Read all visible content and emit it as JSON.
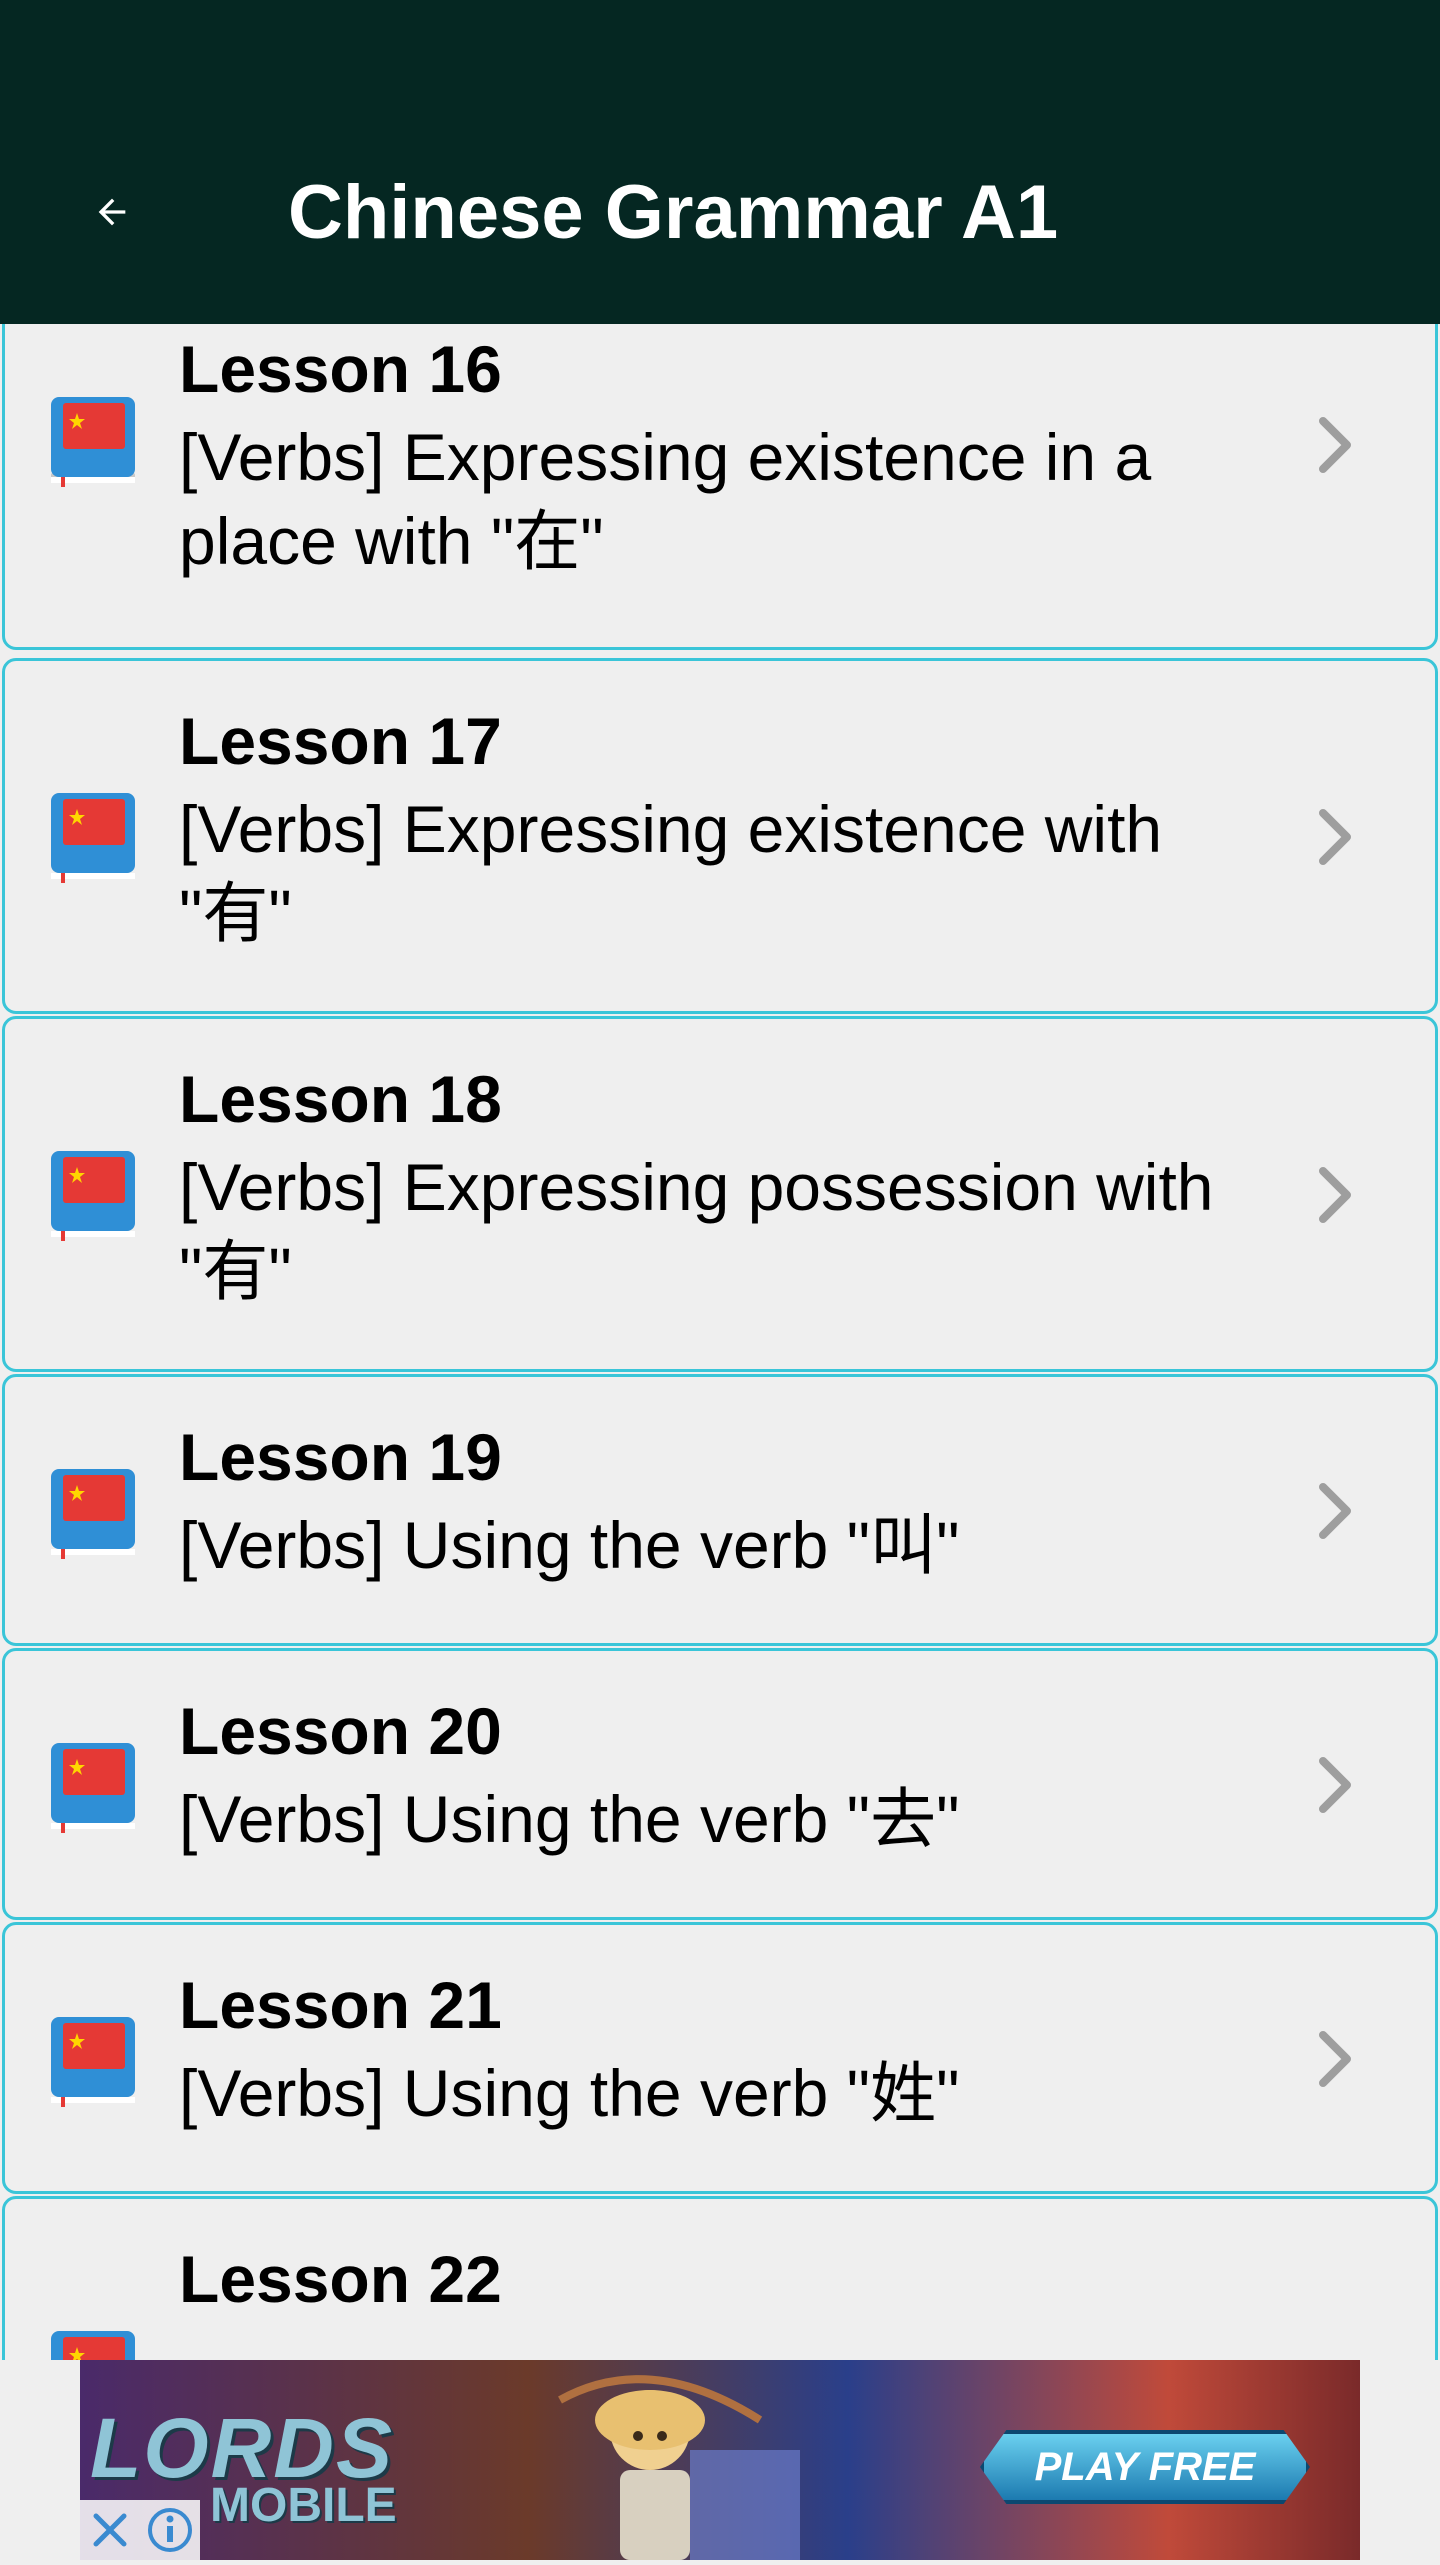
{
  "app_bar": {
    "title": "Chinese Grammar A1",
    "back_icon": "arrow-left-icon",
    "background": "#052722"
  },
  "lessons": [
    {
      "title": "Lesson 16",
      "description": "[Verbs] Expressing existence in a place with \"在\""
    },
    {
      "title": "Lesson 17",
      "description": "[Verbs] Expressing existence with \"有\""
    },
    {
      "title": "Lesson 18",
      "description": "[Verbs] Expressing possession with \"有\""
    },
    {
      "title": "Lesson 19",
      "description": "[Verbs] Using the verb \"叫\""
    },
    {
      "title": "Lesson 20",
      "description": "[Verbs] Using the verb \"去\""
    },
    {
      "title": "Lesson 21",
      "description": "[Verbs] Using the verb \"姓\""
    },
    {
      "title": "Lesson 22",
      "description": ""
    }
  ],
  "ad": {
    "logo": "LORDS",
    "logo_sub": "MOBILE",
    "cta": "PLAY FREE",
    "close_icon": "close-icon",
    "info_icon": "info-icon"
  },
  "colors": {
    "card_border": "#3ac5d8",
    "card_bg": "#efefef",
    "chevron": "#9e9e9e"
  }
}
